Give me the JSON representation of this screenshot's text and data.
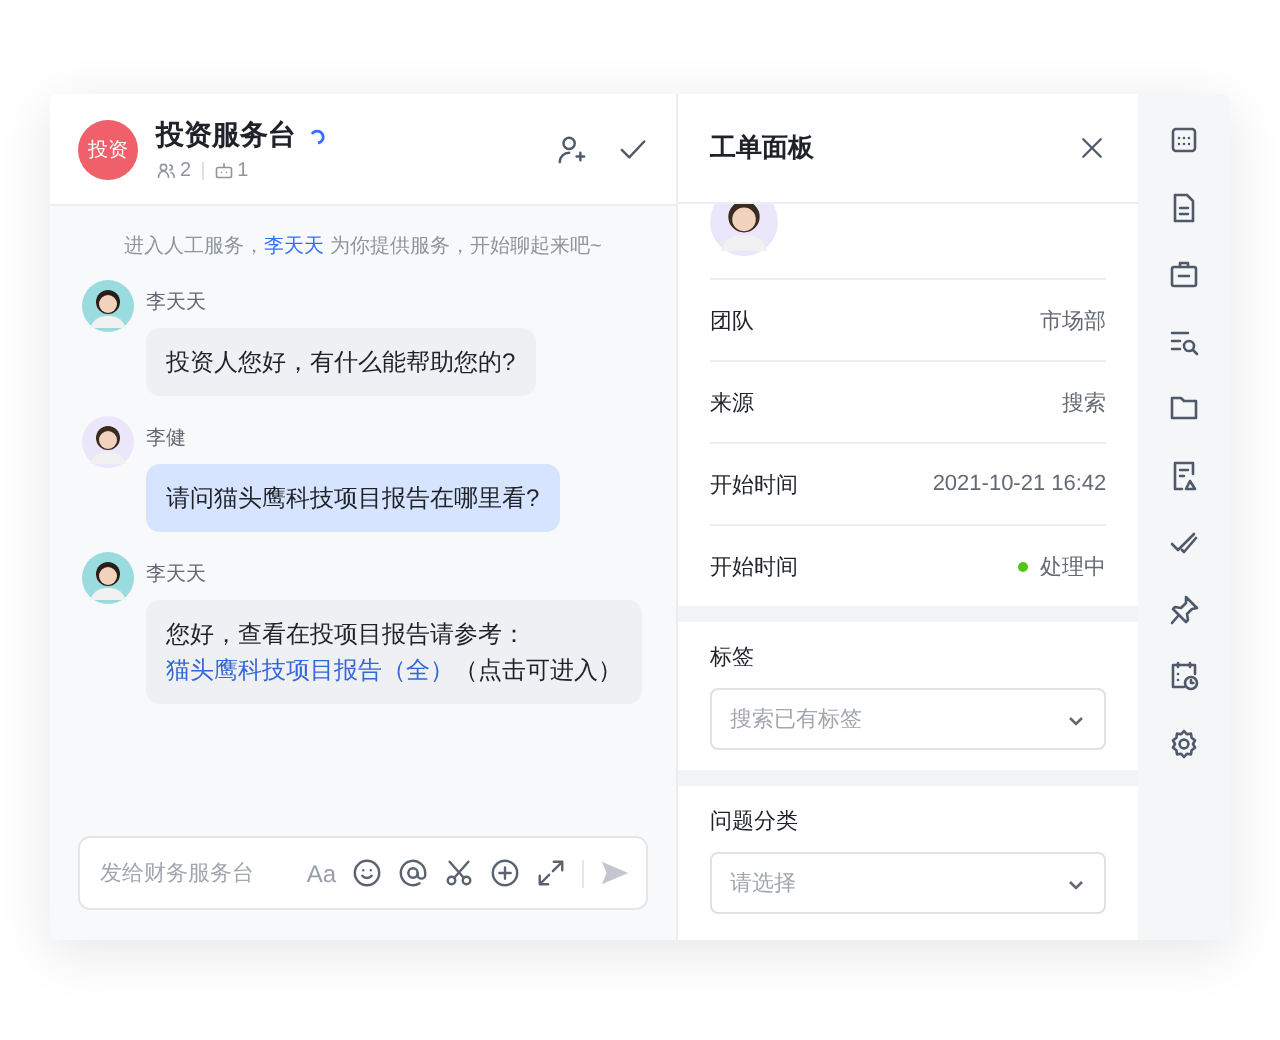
{
  "chat": {
    "avatar_text": "投资",
    "title": "投资服务台",
    "members": "2",
    "bots": "1"
  },
  "notice": {
    "before": "进入人工服务，",
    "agent": "李天天",
    "after": " 为你提供服务，开始聊起来吧~"
  },
  "messages": [
    {
      "sender": "李天天",
      "kind": "agent",
      "text": "投资人您好，有什么能帮助您的?"
    },
    {
      "sender": "李健",
      "kind": "customer",
      "text": "请问猫头鹰科技项目报告在哪里看?"
    },
    {
      "sender": "李天天",
      "kind": "agent",
      "text": "您好，查看在投项目报告请参考：",
      "link": "猫头鹰科技项目报告（全）",
      "note": "（点击可进入）"
    }
  ],
  "composer": {
    "placeholder": "发给财务服务台",
    "font_label": "Aa"
  },
  "panel": {
    "title": "工单面板",
    "fields": [
      {
        "label": "团队",
        "value": "市场部",
        "kind": "text"
      },
      {
        "label": "来源",
        "value": "搜索",
        "kind": "text"
      },
      {
        "label": "开始时间",
        "value": "2021-10-21 16:42",
        "kind": "text"
      },
      {
        "label": "开始时间",
        "value": "处理中",
        "kind": "status",
        "color": "#52c41a"
      }
    ],
    "tags": {
      "label": "标签",
      "placeholder": "搜索已有标签"
    },
    "category": {
      "label": "问题分类",
      "placeholder": "请选择"
    }
  }
}
